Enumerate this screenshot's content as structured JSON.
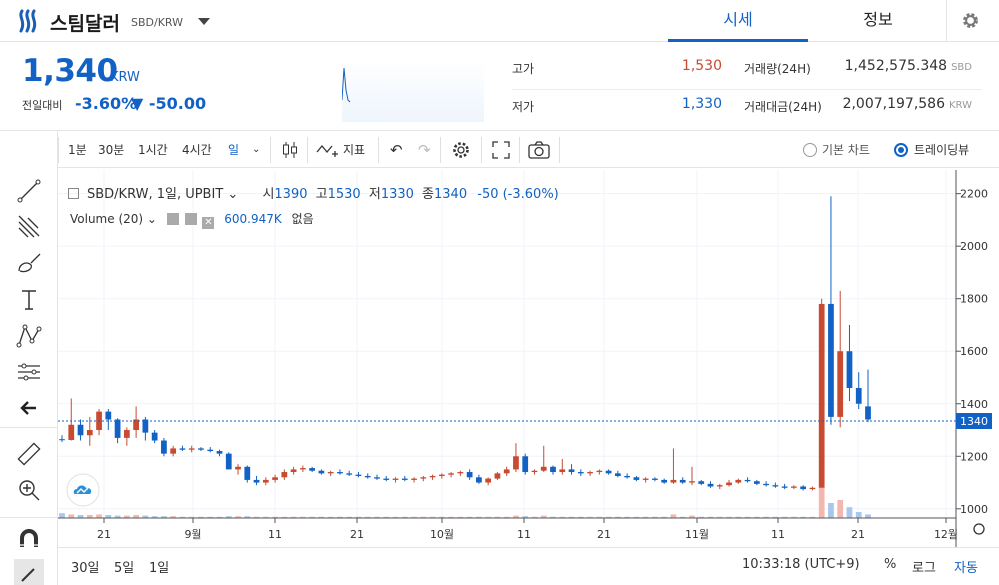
{
  "header": {
    "coin_name": "스팀달러",
    "pair": "SBD/KRW",
    "tabs": [
      "시세",
      "정보"
    ]
  },
  "price": {
    "current": "1,340",
    "unit": "KRW",
    "change_label": "전일대비",
    "change_rate": "-3.60%",
    "change_amount": "▼ -50.00"
  },
  "stats": {
    "high_label": "고가",
    "high": "1,530",
    "low_label": "저가",
    "low": "1,330",
    "volume_label": "거래량(24H)",
    "volume": "1,452,575.348",
    "volume_unit": "SBD",
    "turnover_label": "거래대금(24H)",
    "turnover": "2,007,197,586",
    "turnover_unit": "KRW"
  },
  "toolbar": {
    "intervals": [
      "1분",
      "30분",
      "1시간",
      "4시간",
      "일"
    ],
    "indicator_label": "지표",
    "basic_chart": "기본 차트",
    "trading_view": "트레이딩뷰"
  },
  "legend": {
    "symbol": "SBD/KRW, 1일, UPBIT",
    "open_label": "시",
    "open": "1390",
    "high_label": "고",
    "high": "1530",
    "low_label": "저",
    "low": "1330",
    "close_label": "종",
    "close": "1340",
    "change": "-50 (-3.60%)",
    "volume_label": "Volume (20)",
    "volume_value": "600.947K",
    "volume_extra": "없음"
  },
  "bottom": {
    "ranges": [
      "30일",
      "5일",
      "1일"
    ],
    "clock": "10:33:18 (UTC+9)",
    "percent": "%",
    "log": "로그",
    "auto": "자동"
  },
  "colors": {
    "up": "#c84a31",
    "down": "#1261c4",
    "accent": "#1261c4"
  },
  "chart_data": {
    "type": "candlestick",
    "y_ticks": [
      "2200",
      "2000",
      "1800",
      "1600",
      "1400",
      "1200",
      "1000"
    ],
    "x_ticks": [
      "21",
      "9월",
      "11",
      "21",
      "10월",
      "11",
      "21",
      "11월",
      "11",
      "21",
      "12월"
    ],
    "last_price_label": "1340",
    "ylim": [
      965,
      2290
    ],
    "candles": [
      [
        1265,
        1280,
        1255,
        1262
      ],
      [
        1262,
        1420,
        1260,
        1320
      ],
      [
        1320,
        1340,
        1260,
        1280
      ],
      [
        1280,
        1350,
        1240,
        1300
      ],
      [
        1300,
        1380,
        1280,
        1370
      ],
      [
        1370,
        1380,
        1300,
        1340
      ],
      [
        1340,
        1345,
        1250,
        1270
      ],
      [
        1270,
        1310,
        1240,
        1300
      ],
      [
        1300,
        1390,
        1270,
        1340
      ],
      [
        1340,
        1350,
        1260,
        1290
      ],
      [
        1290,
        1300,
        1250,
        1260
      ],
      [
        1260,
        1270,
        1200,
        1210
      ],
      [
        1210,
        1240,
        1200,
        1230
      ],
      [
        1230,
        1240,
        1220,
        1225
      ],
      [
        1225,
        1240,
        1215,
        1230
      ],
      [
        1230,
        1235,
        1220,
        1225
      ],
      [
        1225,
        1235,
        1215,
        1220
      ],
      [
        1220,
        1225,
        1200,
        1210
      ],
      [
        1210,
        1215,
        1150,
        1150
      ],
      [
        1150,
        1170,
        1130,
        1160
      ],
      [
        1160,
        1165,
        1100,
        1110
      ],
      [
        1110,
        1125,
        1090,
        1100
      ],
      [
        1100,
        1120,
        1090,
        1110
      ],
      [
        1110,
        1130,
        1100,
        1120
      ],
      [
        1120,
        1150,
        1110,
        1140
      ],
      [
        1140,
        1160,
        1130,
        1150
      ],
      [
        1150,
        1165,
        1140,
        1155
      ],
      [
        1155,
        1160,
        1140,
        1145
      ],
      [
        1145,
        1150,
        1130,
        1135
      ],
      [
        1135,
        1145,
        1125,
        1140
      ],
      [
        1140,
        1150,
        1130,
        1135
      ],
      [
        1135,
        1145,
        1125,
        1130
      ],
      [
        1130,
        1140,
        1120,
        1125
      ],
      [
        1125,
        1135,
        1115,
        1120
      ],
      [
        1120,
        1130,
        1110,
        1115
      ],
      [
        1115,
        1125,
        1105,
        1110
      ],
      [
        1110,
        1120,
        1100,
        1115
      ],
      [
        1115,
        1125,
        1105,
        1110
      ],
      [
        1110,
        1120,
        1100,
        1115
      ],
      [
        1115,
        1125,
        1105,
        1120
      ],
      [
        1120,
        1130,
        1110,
        1125
      ],
      [
        1125,
        1135,
        1115,
        1130
      ],
      [
        1130,
        1140,
        1120,
        1135
      ],
      [
        1135,
        1145,
        1125,
        1140
      ],
      [
        1140,
        1150,
        1110,
        1120
      ],
      [
        1120,
        1130,
        1095,
        1100
      ],
      [
        1100,
        1120,
        1090,
        1115
      ],
      [
        1115,
        1140,
        1110,
        1135
      ],
      [
        1135,
        1160,
        1125,
        1150
      ],
      [
        1150,
        1250,
        1140,
        1200
      ],
      [
        1200,
        1210,
        1130,
        1140
      ],
      [
        1140,
        1150,
        1130,
        1145
      ],
      [
        1145,
        1240,
        1140,
        1160
      ],
      [
        1160,
        1165,
        1130,
        1140
      ],
      [
        1140,
        1190,
        1130,
        1150
      ],
      [
        1150,
        1170,
        1130,
        1140
      ],
      [
        1140,
        1150,
        1125,
        1135
      ],
      [
        1135,
        1145,
        1125,
        1140
      ],
      [
        1140,
        1150,
        1130,
        1145
      ],
      [
        1145,
        1150,
        1130,
        1135
      ],
      [
        1135,
        1145,
        1120,
        1125
      ],
      [
        1125,
        1135,
        1115,
        1120
      ],
      [
        1120,
        1125,
        1105,
        1110
      ],
      [
        1110,
        1120,
        1100,
        1115
      ],
      [
        1115,
        1120,
        1105,
        1110
      ],
      [
        1110,
        1115,
        1095,
        1100
      ],
      [
        1100,
        1230,
        1095,
        1110
      ],
      [
        1110,
        1120,
        1095,
        1100
      ],
      [
        1100,
        1160,
        1090,
        1105
      ],
      [
        1105,
        1110,
        1090,
        1095
      ],
      [
        1095,
        1105,
        1080,
        1085
      ],
      [
        1085,
        1095,
        1075,
        1090
      ],
      [
        1090,
        1110,
        1085,
        1100
      ],
      [
        1100,
        1115,
        1095,
        1110
      ],
      [
        1110,
        1120,
        1100,
        1105
      ],
      [
        1105,
        1110,
        1090,
        1095
      ],
      [
        1095,
        1105,
        1085,
        1090
      ],
      [
        1090,
        1100,
        1080,
        1085
      ],
      [
        1085,
        1095,
        1075,
        1080
      ],
      [
        1080,
        1090,
        1075,
        1085
      ],
      [
        1085,
        1090,
        1070,
        1075
      ],
      [
        1075,
        1085,
        1070,
        1080
      ],
      [
        1080,
        1800,
        1080,
        1780
      ],
      [
        1780,
        2190,
        1320,
        1350
      ],
      [
        1350,
        1830,
        1310,
        1600
      ],
      [
        1600,
        1700,
        1410,
        1460
      ],
      [
        1460,
        1520,
        1380,
        1400
      ],
      [
        1390,
        1530,
        1330,
        1340
      ]
    ],
    "volumes": [
      0.8,
      0.6,
      0.5,
      0.5,
      0.6,
      0.5,
      0.4,
      0.4,
      0.5,
      0.4,
      0.3,
      0.3,
      0.3,
      0.2,
      0.2,
      0.2,
      0.2,
      0.2,
      0.3,
      0.3,
      0.3,
      0.2,
      0.2,
      0.2,
      0.2,
      0.2,
      0.2,
      0.2,
      0.2,
      0.2,
      0.2,
      0.2,
      0.2,
      0.2,
      0.2,
      0.2,
      0.2,
      0.2,
      0.2,
      0.2,
      0.2,
      0.2,
      0.2,
      0.2,
      0.2,
      0.2,
      0.2,
      0.2,
      0.2,
      0.4,
      0.3,
      0.2,
      0.4,
      0.2,
      0.2,
      0.2,
      0.2,
      0.2,
      0.2,
      0.2,
      0.2,
      0.2,
      0.2,
      0.2,
      0.2,
      0.2,
      0.6,
      0.2,
      0.4,
      0.2,
      0.2,
      0.2,
      0.2,
      0.2,
      0.2,
      0.2,
      0.2,
      0.2,
      0.2,
      0.2,
      0.2,
      0.2,
      5.0,
      2.5,
      3.0,
      1.8,
      1.0,
      0.6
    ]
  }
}
